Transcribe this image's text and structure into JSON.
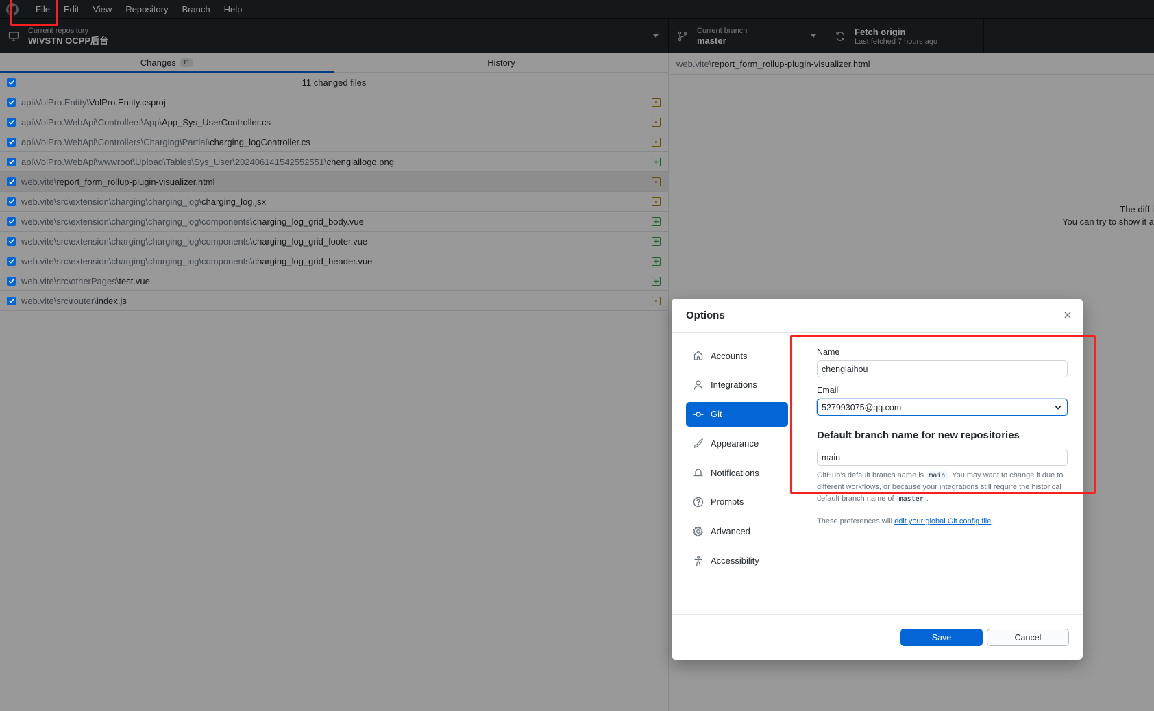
{
  "menubar": {
    "items": [
      "File",
      "Edit",
      "View",
      "Repository",
      "Branch",
      "Help"
    ]
  },
  "toolbar": {
    "repo": {
      "label": "Current repository",
      "value": "WIVSTN OCPP后台",
      "icon": "desktop-icon"
    },
    "branch": {
      "label": "Current branch",
      "value": "master",
      "icon": "git-branch-icon"
    },
    "fetch": {
      "label": "Fetch origin",
      "sublabel": "Last fetched 7 hours ago",
      "icon": "sync-icon"
    }
  },
  "changes": {
    "tabs": [
      {
        "label": "Changes",
        "count": "11",
        "active": true
      },
      {
        "label": "History",
        "active": false
      }
    ],
    "summary": "11 changed files",
    "files": [
      {
        "dir": "api\\VolPro.Entity\\",
        "name": "VolPro.Entity.csproj",
        "status": "modified",
        "checked": true
      },
      {
        "dir": "api\\VolPro.WebApi\\Controllers\\App\\",
        "name": "App_Sys_UserController.cs",
        "status": "modified",
        "checked": true
      },
      {
        "dir": "api\\VolPro.WebApi\\Controllers\\Charging\\Partial\\",
        "name": "charging_logController.cs",
        "status": "modified",
        "checked": true
      },
      {
        "dir": "api\\VolPro.WebApi\\wwwroot\\Upload\\Tables\\Sys_User\\202406141542552551\\",
        "name": "chenglailogo.png",
        "status": "added",
        "checked": true
      },
      {
        "dir": "web.vite\\",
        "name": "report_form_rollup-plugin-visualizer.html",
        "status": "modified",
        "checked": true,
        "selected": true
      },
      {
        "dir": "web.vite\\src\\extension\\charging\\charging_log\\",
        "name": "charging_log.jsx",
        "status": "modified",
        "checked": true
      },
      {
        "dir": "web.vite\\src\\extension\\charging\\charging_log\\components\\",
        "name": "charging_log_grid_body.vue",
        "status": "added",
        "checked": true
      },
      {
        "dir": "web.vite\\src\\extension\\charging\\charging_log\\components\\",
        "name": "charging_log_grid_footer.vue",
        "status": "added",
        "checked": true
      },
      {
        "dir": "web.vite\\src\\extension\\charging\\charging_log\\components\\",
        "name": "charging_log_grid_header.vue",
        "status": "added",
        "checked": true
      },
      {
        "dir": "web.vite\\src\\otherPages\\",
        "name": "test.vue",
        "status": "added",
        "checked": true
      },
      {
        "dir": "web.vite\\src\\router\\",
        "name": "index.js",
        "status": "modified",
        "checked": true
      }
    ]
  },
  "diff": {
    "path_dir": "web.vite\\",
    "path_name": "report_form_rollup-plugin-visualizer.html",
    "message_line1": "The diff i",
    "message_line2": "You can try to show it a"
  },
  "dialog": {
    "title": "Options",
    "nav": [
      {
        "label": "Accounts",
        "icon": "home-icon"
      },
      {
        "label": "Integrations",
        "icon": "person-icon"
      },
      {
        "label": "Git",
        "icon": "git-commit-icon",
        "active": true
      },
      {
        "label": "Appearance",
        "icon": "paintbrush-icon"
      },
      {
        "label": "Notifications",
        "icon": "bell-icon"
      },
      {
        "label": "Prompts",
        "icon": "question-icon"
      },
      {
        "label": "Advanced",
        "icon": "gear-icon"
      },
      {
        "label": "Accessibility",
        "icon": "accessibility-icon"
      }
    ],
    "git": {
      "name_label": "Name",
      "name_value": "chenglaihou",
      "email_label": "Email",
      "email_value": "527993075@qq.com",
      "branch_section_title": "Default branch name for new repositories",
      "branch_value": "main",
      "help_part1": "GitHub's default branch name is ",
      "help_code1": "main",
      "help_part2": ". You may want to change it due to different workflows, or because your integrations still require the historical default branch name of ",
      "help_code2": "master",
      "help_part3": ".",
      "prefs_prefix": "These preferences will ",
      "prefs_link": "edit your global Git config file",
      "prefs_suffix": "."
    },
    "buttons": {
      "save": "Save",
      "cancel": "Cancel"
    }
  },
  "colors": {
    "accent": "#0366d6",
    "modified": "#b08800",
    "added": "#28a745",
    "annotation": "#ff1f1f"
  }
}
